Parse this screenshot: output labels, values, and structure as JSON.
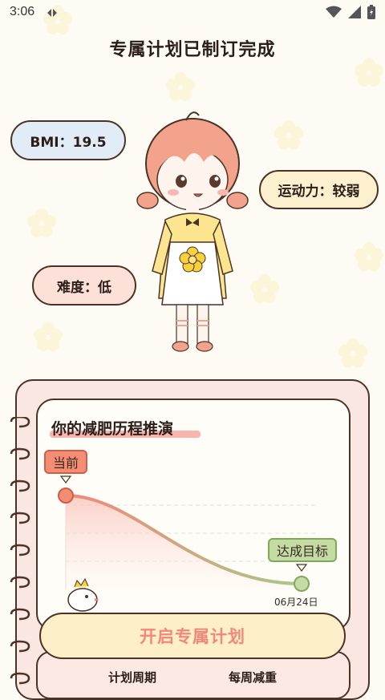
{
  "status_bar": {
    "time": "3:06"
  },
  "page_title": "专属计划已制订完成",
  "stats": {
    "bmi": "BMI：19.5",
    "exercise": "运动力：较弱",
    "difficulty": "难度：低"
  },
  "chart_card": {
    "title": "你的减肥历程推演",
    "current_tag": "当前",
    "goal_tag": "达成目标",
    "goal_date": "06月24日"
  },
  "chart_data": {
    "type": "line",
    "title": "你的减肥历程推演",
    "points": [
      {
        "label": "当前",
        "value": 1.0
      },
      {
        "label": "达成目标",
        "date": "06月24日",
        "value": 0.0
      }
    ],
    "grid": true
  },
  "cta_button": "开启专属计划",
  "plan_summary": {
    "period_label": "计划周期",
    "weekly_label": "每周减重"
  },
  "colors": {
    "background": "#fdfbf3",
    "accent_pink": "#f2877a",
    "accent_green": "#a8c98a",
    "outline": "#4a3226"
  }
}
